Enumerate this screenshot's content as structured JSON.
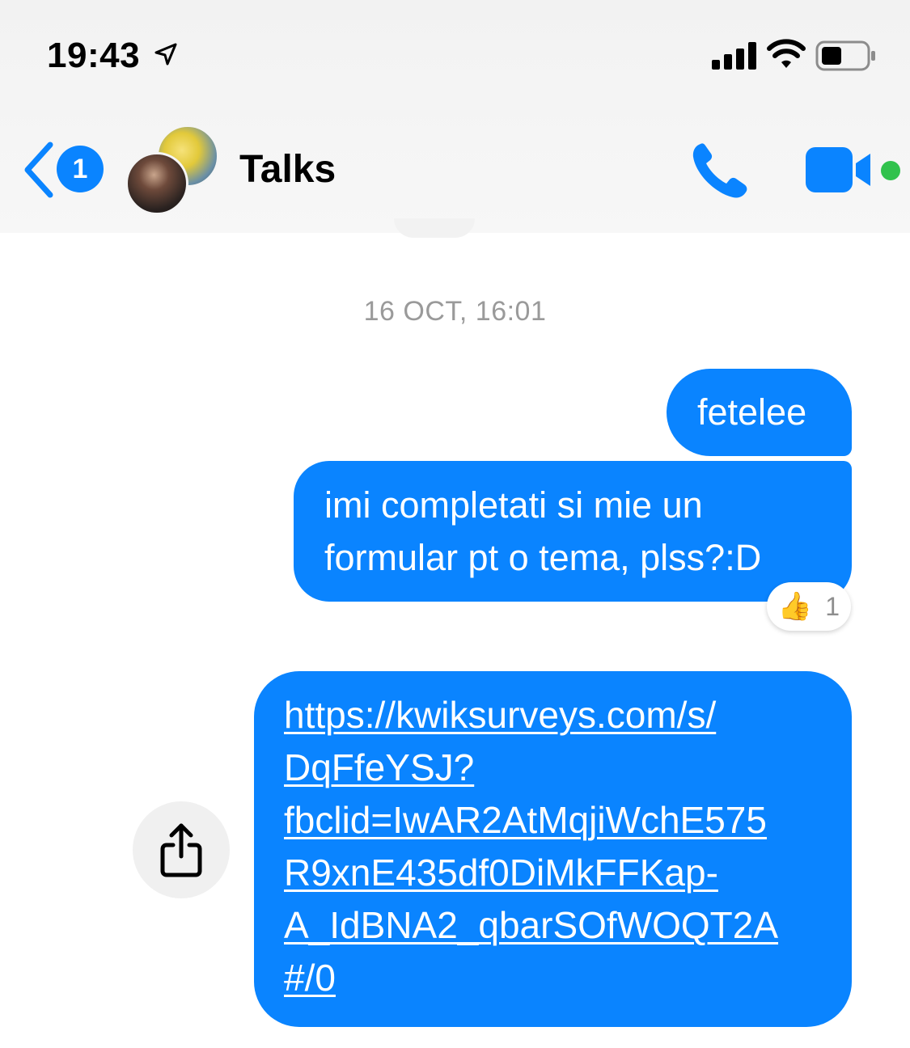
{
  "status_bar": {
    "time": "19:43",
    "icons": [
      "location-arrow-icon",
      "signal-icon",
      "wifi-icon",
      "battery-icon"
    ]
  },
  "header": {
    "back_badge_count": "1",
    "title": "Talks",
    "icons": [
      "back-chevron-icon",
      "phone-icon",
      "video-camera-icon"
    ],
    "accent_color": "#0a84ff",
    "active_status_color": "#31c24d"
  },
  "conversation": {
    "timestamp": "16 OCT, 16:01",
    "messages": [
      {
        "text": "fetelee",
        "direction": "outgoing"
      },
      {
        "text_line1": "imi completati si mie un",
        "text_line2": "formular pt o tema, plss?:D",
        "direction": "outgoing",
        "reaction": {
          "emoji": "👍",
          "count": "1"
        }
      },
      {
        "link_lines": [
          "https://kwiksurveys.com/s/",
          "DqFfeYSJ?",
          "fbclid=IwAR2AtMqjiWchE575",
          "R9xnE435df0DiMkFFKap-",
          "A_IdBNA2_qbarSOfWOQT2A",
          "#/0"
        ],
        "direction": "outgoing"
      }
    ],
    "share_icon": "share-icon"
  }
}
